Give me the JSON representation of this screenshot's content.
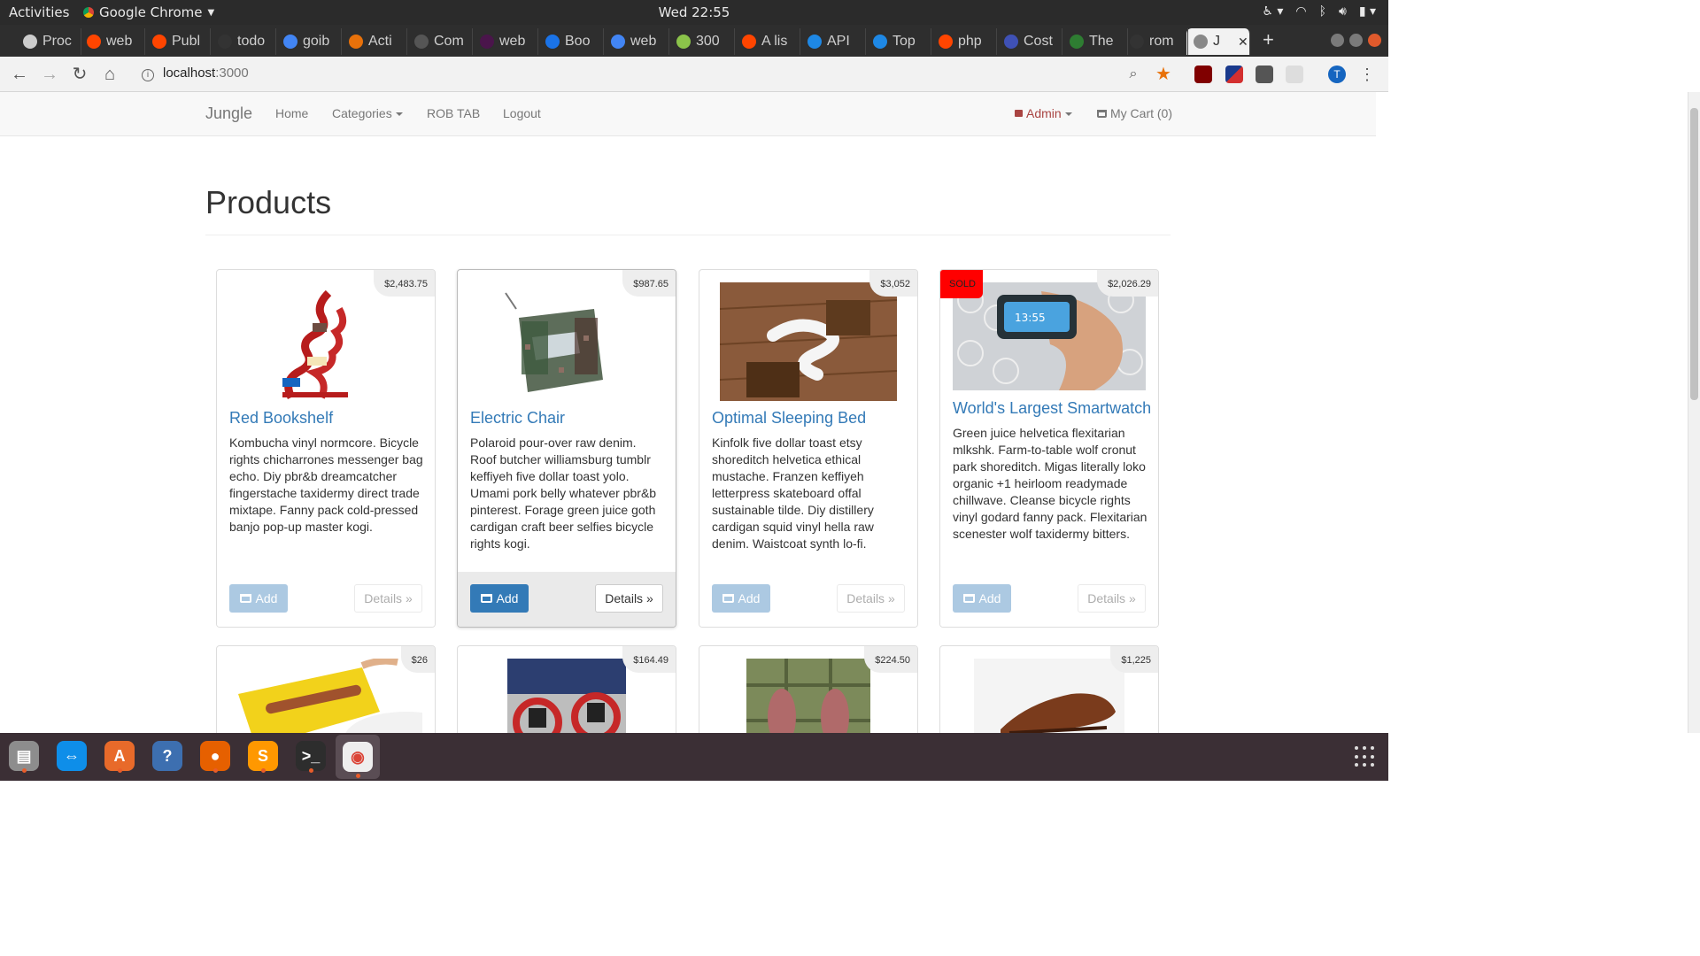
{
  "system": {
    "activities": "Activities",
    "app_name": "Google Chrome",
    "clock": "Wed 22:55"
  },
  "tabs": [
    {
      "label": "Proc",
      "icon": "trello-icon",
      "color": "#cccccc"
    },
    {
      "label": "web",
      "icon": "reddit-icon",
      "color": "#ff4500"
    },
    {
      "label": "Publ",
      "icon": "reddit-icon",
      "color": "#ff4500"
    },
    {
      "label": "todo",
      "icon": "github-icon",
      "color": "#333333"
    },
    {
      "label": "goib",
      "icon": "google-icon",
      "color": "#4285f4"
    },
    {
      "label": "Acti",
      "icon": "activity-icon",
      "color": "#e8710a"
    },
    {
      "label": "Com",
      "icon": "circle-icon",
      "color": "#555555"
    },
    {
      "label": "web",
      "icon": "slack-icon",
      "color": "#4a154b"
    },
    {
      "label": "Boo",
      "icon": "star-icon",
      "color": "#1a73e8"
    },
    {
      "label": "web",
      "icon": "google-icon",
      "color": "#4285f4"
    },
    {
      "label": "300",
      "icon": "chart-icon",
      "color": "#8bc34a"
    },
    {
      "label": "A lis",
      "icon": "reddit-icon",
      "color": "#ff4500"
    },
    {
      "label": "API",
      "icon": "puzzle-icon",
      "color": "#1e88e5"
    },
    {
      "label": "Top",
      "icon": "puzzle-icon",
      "color": "#1e88e5"
    },
    {
      "label": "php",
      "icon": "reddit-icon",
      "color": "#ff4500"
    },
    {
      "label": "Cost",
      "icon": "car-icon",
      "color": "#3f51b5"
    },
    {
      "label": "The",
      "icon": "cr-icon",
      "color": "#2e7d32"
    },
    {
      "label": "rom",
      "icon": "github-icon",
      "color": "#333333"
    },
    {
      "label": "J",
      "icon": "page-icon",
      "color": "#888888"
    }
  ],
  "address": {
    "host": "localhost",
    "port": ":3000"
  },
  "site": {
    "brand": "Jungle",
    "nav": {
      "home": "Home",
      "categories": "Categories",
      "rob_tab": "ROB TAB",
      "logout": "Logout",
      "admin": "Admin",
      "cart": "My Cart (0)"
    },
    "page_title": "Products"
  },
  "products": [
    {
      "name": "Red Bookshelf",
      "price": "$2,483.75",
      "sold": false,
      "image": "bookshelf",
      "description": "Kombucha vinyl normcore. Bicycle rights chicharrones messenger bag echo. Diy pbr&b dreamcatcher fingerstache taxidermy direct trade mixtape. Fanny pack cold-pressed banjo pop-up master kogi."
    },
    {
      "name": "Electric Chair",
      "price": "$987.65",
      "sold": false,
      "image": "chair",
      "description": "Polaroid pour-over raw denim. Roof butcher williamsburg tumblr keffiyeh five dollar toast yolo. Umami pork belly whatever pbr&b pinterest. Forage green juice goth cardigan craft beer selfies bicycle rights kogi."
    },
    {
      "name": "Optimal Sleeping Bed",
      "price": "$3,052",
      "sold": false,
      "image": "bed",
      "description": "Kinfolk five dollar toast etsy shoreditch helvetica ethical mustache. Franzen keffiyeh letterpress skateboard offal sustainable tilde. Diy distillery cardigan squid vinyl hella raw denim. Waistcoat synth lo-fi."
    },
    {
      "name": "World's Largest Smartwatch",
      "price": "$2,026.29",
      "sold": true,
      "image": "watch",
      "description": "Green juice helvetica flexitarian mlkshk. Farm-to-table wolf cronut park shoreditch. Migas literally loko organic +1 heirloom readymade chillwave. Cleanse bicycle rights vinyl godard fanny pack. Flexitarian scenester wolf taxidermy bitters."
    },
    {
      "name": "",
      "price": "$26",
      "sold": false,
      "image": "hotdog",
      "description": ""
    },
    {
      "name": "",
      "price": "$164.49",
      "sold": false,
      "image": "skates",
      "description": ""
    },
    {
      "name": "",
      "price": "$224.50",
      "sold": false,
      "image": "shoes",
      "description": ""
    },
    {
      "name": "",
      "price": "$1,225",
      "sold": false,
      "image": "dressshoe",
      "description": ""
    }
  ],
  "labels": {
    "add": "Add",
    "details": "Details »",
    "sold": "SOLD"
  },
  "dock": [
    {
      "icon": "files-icon",
      "running": true
    },
    {
      "icon": "teamviewer-icon",
      "running": false
    },
    {
      "icon": "software-store-icon",
      "running": true
    },
    {
      "icon": "help-icon",
      "running": false
    },
    {
      "icon": "firefox-icon",
      "running": true
    },
    {
      "icon": "sublime-text-icon",
      "running": true
    },
    {
      "icon": "terminal-icon",
      "running": true
    },
    {
      "icon": "chrome-icon",
      "running": true
    }
  ]
}
